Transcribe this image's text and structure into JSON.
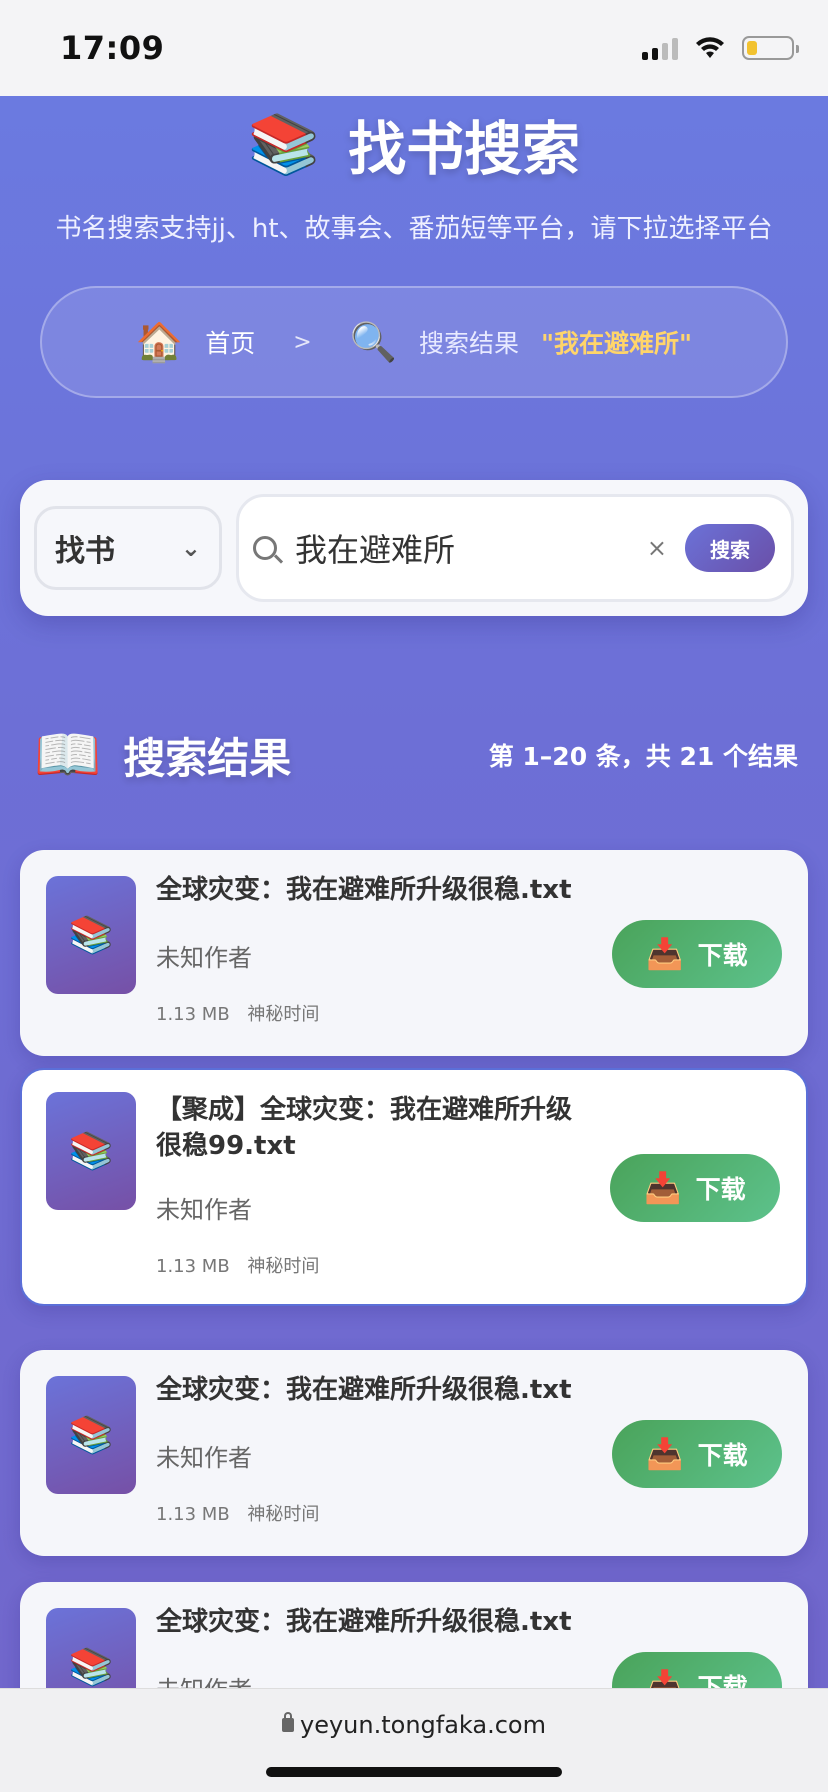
{
  "status_bar": {
    "time": "17:09"
  },
  "header": {
    "title": "找书搜索",
    "title_icon": "books-emoji",
    "subtitle": "书名搜索支持jj、ht、故事会、番茄短等平台，请下拉选择平台"
  },
  "breadcrumb": {
    "home_label": "首页",
    "separator": ">",
    "current_label": "搜索结果",
    "query": "\"我在避难所\""
  },
  "search": {
    "type_selected": "找书",
    "value": "我在避难所",
    "clear_label": "×",
    "button_label": "搜索"
  },
  "results": {
    "title": "搜索结果",
    "count_text": "第 1–20 条，共 21 个结果",
    "items": [
      {
        "title": "全球灾变：我在避难所升级很稳.txt",
        "author": "未知作者",
        "size": "1.13 MB",
        "time": "神秘时间",
        "download_label": "下载"
      },
      {
        "title": "【聚成】全球灾变：我在避难所升级很稳99.txt",
        "author": "未知作者",
        "size": "1.13 MB",
        "time": "神秘时间",
        "download_label": "下载"
      },
      {
        "title": "全球灾变：我在避难所升级很稳.txt",
        "author": "未知作者",
        "size": "1.13 MB",
        "time": "神秘时间",
        "download_label": "下载"
      },
      {
        "title": "全球灾变：我在避难所升级很稳.txt",
        "author": "未知作者",
        "size": "",
        "time": "",
        "download_label": "下载"
      }
    ]
  },
  "browser": {
    "url": "yeyun.tongfaka.com"
  },
  "colors": {
    "page_gradient_top": "#6b7ae0",
    "page_gradient_bottom": "#7167cc",
    "query_highlight": "#ffd56a",
    "download_green": "#4aa35a",
    "search_button": "#6a4fa8"
  }
}
